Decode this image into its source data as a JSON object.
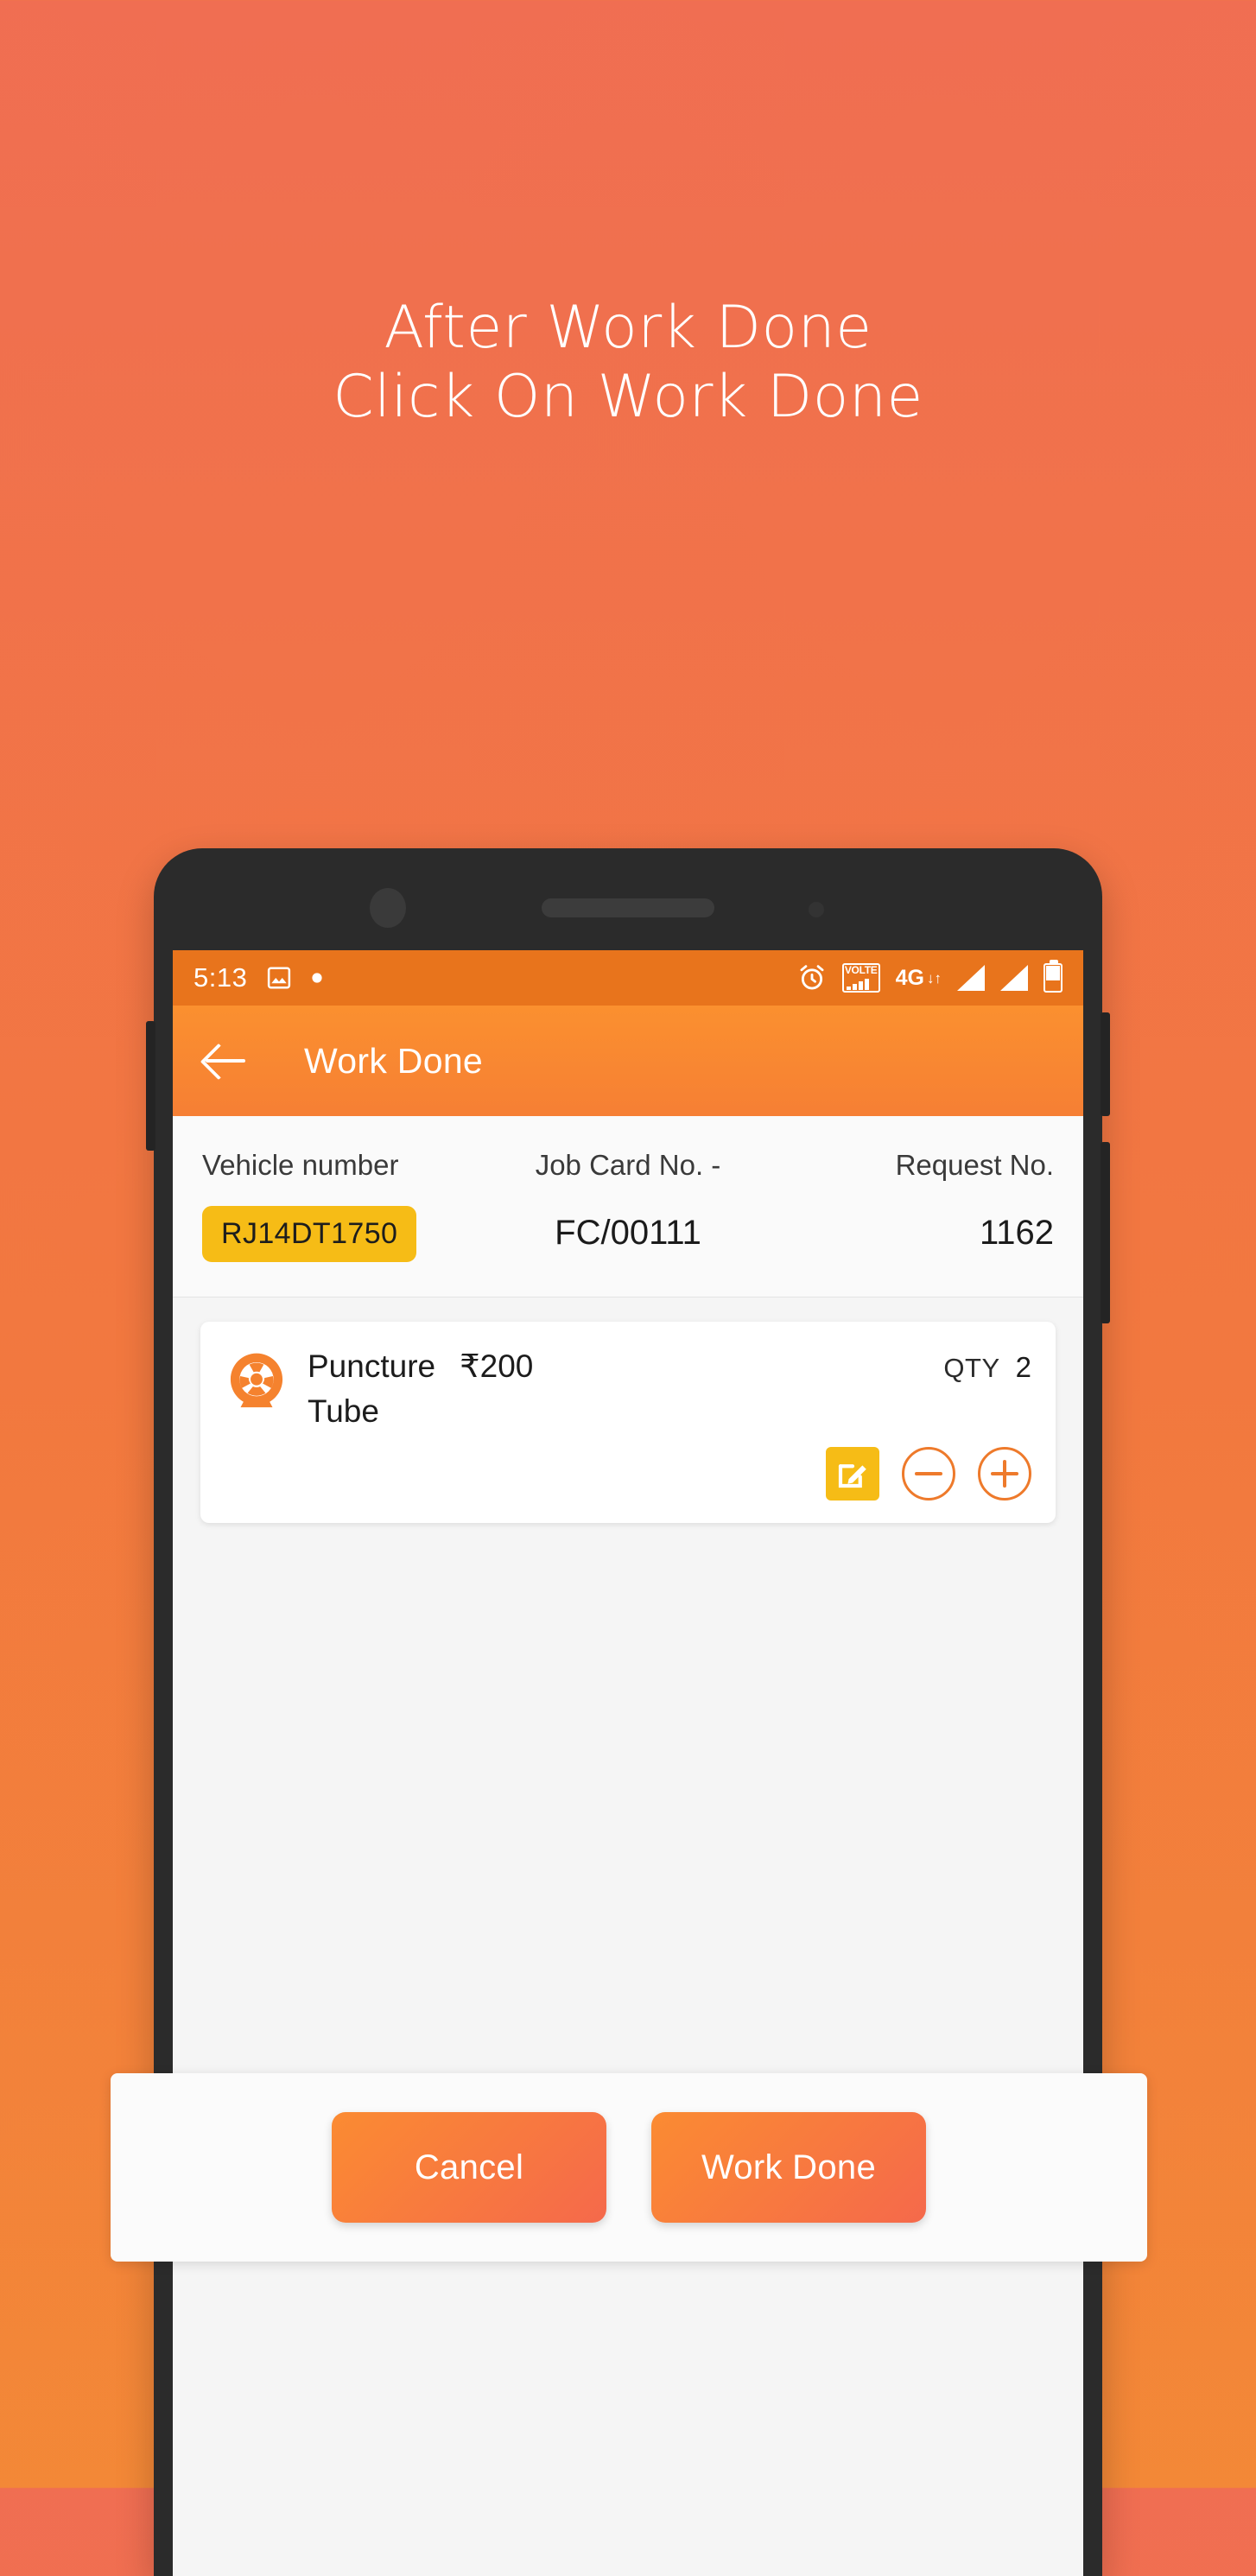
{
  "promo": {
    "line1": "After Work Done",
    "line2": "Click On Work Done"
  },
  "colors": {
    "background_top": "#F06E52",
    "background_bottom": "#F38837",
    "appbar": "#FB902F",
    "accent_orange": "#EE7A2B",
    "badge_yellow": "#F6BC16",
    "statusbar": "#E8741C",
    "screen_bg": "#F5F5F5"
  },
  "statusbar": {
    "time": "5:13",
    "left_icons": [
      "image-icon",
      "dot-icon"
    ],
    "right_icons": [
      "alarm-icon",
      "volte-icon",
      "4g-icon",
      "signal-icon",
      "signal-icon",
      "battery-icon"
    ],
    "volte_label": "VOLTE",
    "network_label": "4G"
  },
  "appbar": {
    "back_icon": "back-arrow-icon",
    "title": "Work Done"
  },
  "info": {
    "columns": [
      {
        "label": "Vehicle number",
        "value": "RJ14DT1750",
        "style": "badge"
      },
      {
        "label": "Job Card No. -",
        "value": "FC/00111",
        "style": "plain"
      },
      {
        "label": "Request No.",
        "value": "1162",
        "style": "plain"
      }
    ]
  },
  "item": {
    "icon": "tyre-puncture-icon",
    "name": "Puncture",
    "name_line2": "Tube",
    "price": "₹200",
    "qty_label": "QTY",
    "qty_value": "2",
    "actions": [
      {
        "name": "edit-button",
        "icon": "edit-pencil-icon"
      },
      {
        "name": "decrement-button",
        "icon": "minus-circle-icon"
      },
      {
        "name": "increment-button",
        "icon": "plus-circle-icon"
      }
    ]
  },
  "actionbar": {
    "cancel_label": "Cancel",
    "confirm_label": "Work Done"
  }
}
